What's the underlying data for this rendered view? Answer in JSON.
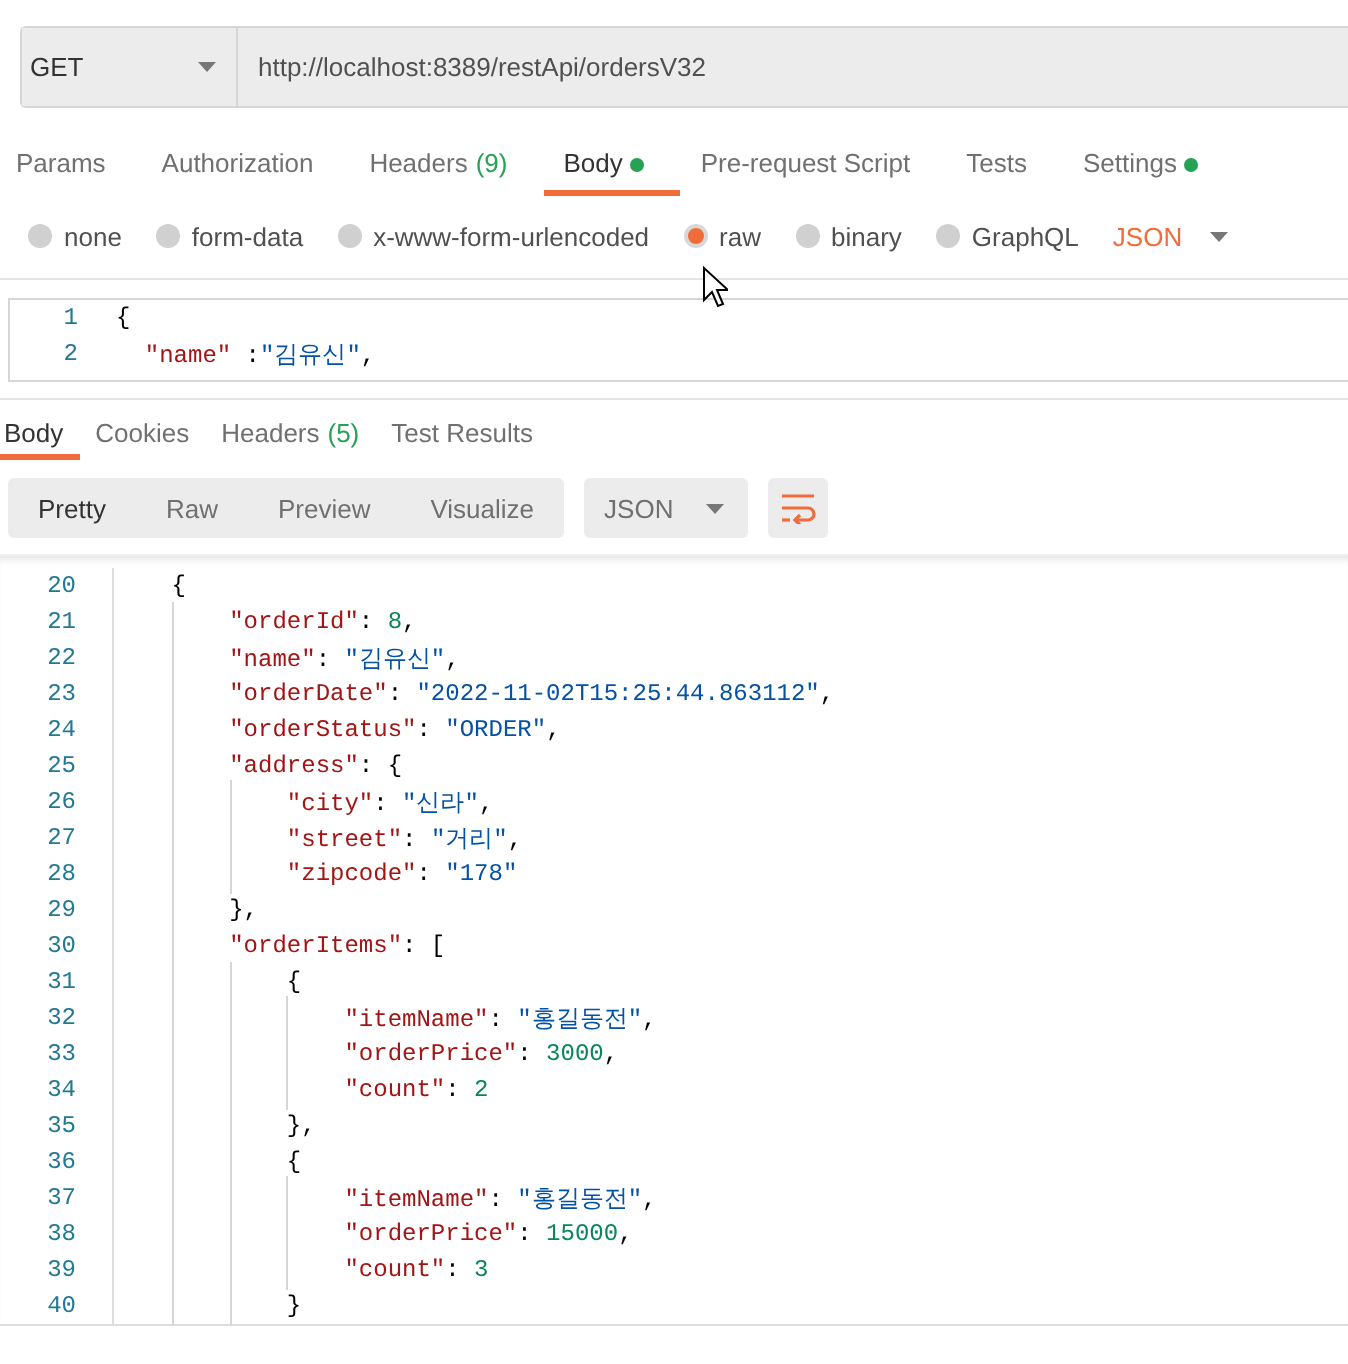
{
  "request": {
    "method": "GET",
    "url": "http://localhost:8389/restApi/ordersV32"
  },
  "request_tabs": [
    {
      "label": "Params",
      "selected": false
    },
    {
      "label": "Authorization",
      "selected": false
    },
    {
      "label": "Headers",
      "count": "(9)",
      "selected": false
    },
    {
      "label": "Body",
      "dot": true,
      "selected": true
    },
    {
      "label": "Pre-request Script",
      "selected": false
    },
    {
      "label": "Tests",
      "selected": false
    },
    {
      "label": "Settings",
      "dot": true,
      "selected": false
    }
  ],
  "body_types": [
    {
      "label": "none",
      "selected": false
    },
    {
      "label": "form-data",
      "selected": false
    },
    {
      "label": "x-www-form-urlencoded",
      "selected": false
    },
    {
      "label": "raw",
      "selected": true
    },
    {
      "label": "binary",
      "selected": false
    },
    {
      "label": "GraphQL",
      "selected": false
    }
  ],
  "body_format": "JSON",
  "request_body": {
    "lines": [
      {
        "number": "1",
        "tokens": [
          {
            "kind": "punct",
            "text": "{"
          }
        ]
      },
      {
        "number": "2",
        "tokens": [
          {
            "kind": "key",
            "text": "  \"name\""
          },
          {
            "kind": "punct",
            "text": " :"
          },
          {
            "kind": "string",
            "text": "\"김유신\""
          },
          {
            "kind": "punct",
            "text": ","
          }
        ]
      }
    ]
  },
  "response_tabs": [
    {
      "label": "Body",
      "selected": true
    },
    {
      "label": "Cookies",
      "selected": false
    },
    {
      "label": "Headers",
      "count": "(5)",
      "selected": false
    },
    {
      "label": "Test Results",
      "selected": false
    }
  ],
  "view_modes": [
    {
      "label": "Pretty",
      "selected": true
    },
    {
      "label": "Raw",
      "selected": false
    },
    {
      "label": "Preview",
      "selected": false
    },
    {
      "label": "Visualize",
      "selected": false
    }
  ],
  "response_format": "JSON",
  "wrap_lines": true,
  "response_body": {
    "lines": [
      {
        "number": "20",
        "tokens": [
          {
            "kind": "punct",
            "text": "    {"
          }
        ]
      },
      {
        "number": "21",
        "tokens": [
          {
            "kind": "key",
            "text": "        \"orderId\""
          },
          {
            "kind": "punct",
            "text": ": "
          },
          {
            "kind": "number",
            "text": "8"
          },
          {
            "kind": "punct",
            "text": ","
          }
        ]
      },
      {
        "number": "22",
        "tokens": [
          {
            "kind": "key",
            "text": "        \"name\""
          },
          {
            "kind": "punct",
            "text": ": "
          },
          {
            "kind": "string",
            "text": "\"김유신\""
          },
          {
            "kind": "punct",
            "text": ","
          }
        ]
      },
      {
        "number": "23",
        "tokens": [
          {
            "kind": "key",
            "text": "        \"orderDate\""
          },
          {
            "kind": "punct",
            "text": ": "
          },
          {
            "kind": "string",
            "text": "\"2022-11-02T15:25:44.863112\""
          },
          {
            "kind": "punct",
            "text": ","
          }
        ]
      },
      {
        "number": "24",
        "tokens": [
          {
            "kind": "key",
            "text": "        \"orderStatus\""
          },
          {
            "kind": "punct",
            "text": ": "
          },
          {
            "kind": "string",
            "text": "\"ORDER\""
          },
          {
            "kind": "punct",
            "text": ","
          }
        ]
      },
      {
        "number": "25",
        "tokens": [
          {
            "kind": "key",
            "text": "        \"address\""
          },
          {
            "kind": "punct",
            "text": ": {"
          }
        ]
      },
      {
        "number": "26",
        "tokens": [
          {
            "kind": "key",
            "text": "            \"city\""
          },
          {
            "kind": "punct",
            "text": ": "
          },
          {
            "kind": "string",
            "text": "\"신라\""
          },
          {
            "kind": "punct",
            "text": ","
          }
        ]
      },
      {
        "number": "27",
        "tokens": [
          {
            "kind": "key",
            "text": "            \"street\""
          },
          {
            "kind": "punct",
            "text": ": "
          },
          {
            "kind": "string",
            "text": "\"거리\""
          },
          {
            "kind": "punct",
            "text": ","
          }
        ]
      },
      {
        "number": "28",
        "tokens": [
          {
            "kind": "key",
            "text": "            \"zipcode\""
          },
          {
            "kind": "punct",
            "text": ": "
          },
          {
            "kind": "string",
            "text": "\"178\""
          }
        ]
      },
      {
        "number": "29",
        "tokens": [
          {
            "kind": "punct",
            "text": "        },"
          }
        ]
      },
      {
        "number": "30",
        "tokens": [
          {
            "kind": "key",
            "text": "        \"orderItems\""
          },
          {
            "kind": "punct",
            "text": ": ["
          }
        ]
      },
      {
        "number": "31",
        "tokens": [
          {
            "kind": "punct",
            "text": "            {"
          }
        ]
      },
      {
        "number": "32",
        "tokens": [
          {
            "kind": "key",
            "text": "                \"itemName\""
          },
          {
            "kind": "punct",
            "text": ": "
          },
          {
            "kind": "string",
            "text": "\"홍길동전\""
          },
          {
            "kind": "punct",
            "text": ","
          }
        ]
      },
      {
        "number": "33",
        "tokens": [
          {
            "kind": "key",
            "text": "                \"orderPrice\""
          },
          {
            "kind": "punct",
            "text": ": "
          },
          {
            "kind": "number",
            "text": "3000"
          },
          {
            "kind": "punct",
            "text": ","
          }
        ]
      },
      {
        "number": "34",
        "tokens": [
          {
            "kind": "key",
            "text": "                \"count\""
          },
          {
            "kind": "punct",
            "text": ": "
          },
          {
            "kind": "number",
            "text": "2"
          }
        ]
      },
      {
        "number": "35",
        "tokens": [
          {
            "kind": "punct",
            "text": "            },"
          }
        ]
      },
      {
        "number": "36",
        "tokens": [
          {
            "kind": "punct",
            "text": "            {"
          }
        ]
      },
      {
        "number": "37",
        "tokens": [
          {
            "kind": "key",
            "text": "                \"itemName\""
          },
          {
            "kind": "punct",
            "text": ": "
          },
          {
            "kind": "string",
            "text": "\"홍길동전\""
          },
          {
            "kind": "punct",
            "text": ","
          }
        ]
      },
      {
        "number": "38",
        "tokens": [
          {
            "kind": "key",
            "text": "                \"orderPrice\""
          },
          {
            "kind": "punct",
            "text": ": "
          },
          {
            "kind": "number",
            "text": "15000"
          },
          {
            "kind": "punct",
            "text": ","
          }
        ]
      },
      {
        "number": "39",
        "tokens": [
          {
            "kind": "key",
            "text": "                \"count\""
          },
          {
            "kind": "punct",
            "text": ": "
          },
          {
            "kind": "number",
            "text": "3"
          }
        ]
      },
      {
        "number": "40",
        "tokens": [
          {
            "kind": "punct",
            "text": "            }"
          }
        ]
      }
    ]
  }
}
